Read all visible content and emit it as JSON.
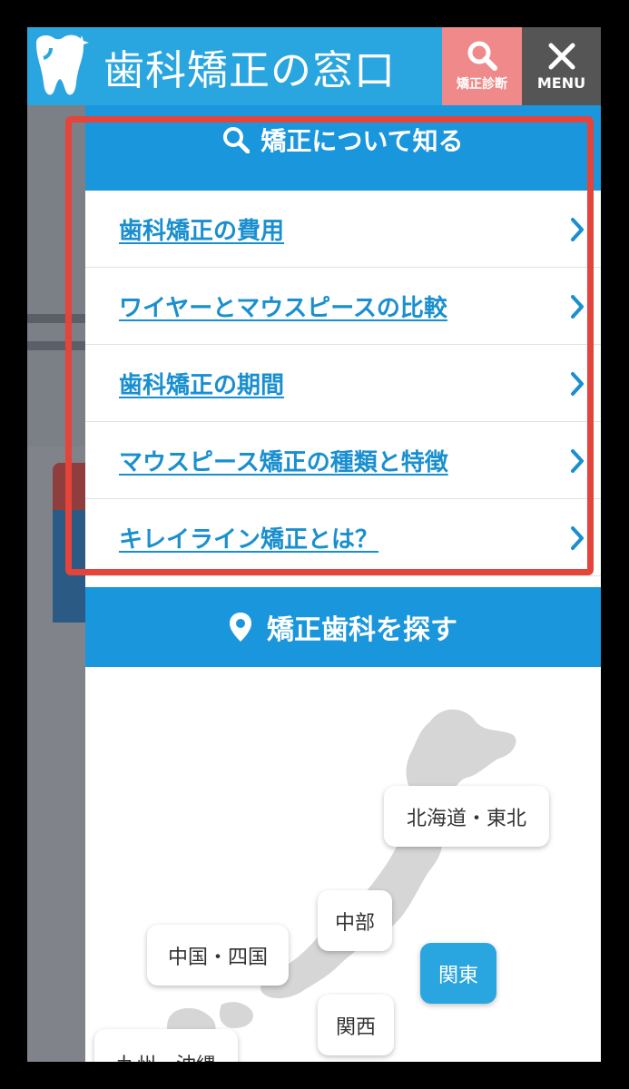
{
  "header": {
    "site_title": "歯科矯正の窓口",
    "diagnosis_label": "矯正診断",
    "menu_label": "MENU"
  },
  "drawer": {
    "learn_section": {
      "heading": "矯正について知る",
      "items": [
        {
          "label": "歯科矯正の費用"
        },
        {
          "label": "ワイヤーとマウスピースの比較"
        },
        {
          "label": "歯科矯正の期間"
        },
        {
          "label": "マウスピース矯正の種類と特徴"
        },
        {
          "label": "キレイライン矯正とは？"
        }
      ]
    },
    "search_section": {
      "heading": "矯正歯科を探す",
      "regions": [
        {
          "label": "北海道・東北",
          "active": false
        },
        {
          "label": "中部",
          "active": false
        },
        {
          "label": "中国・四国",
          "active": false
        },
        {
          "label": "関東",
          "active": true
        },
        {
          "label": "関西",
          "active": false
        },
        {
          "label": "九州・沖縄",
          "active": false
        }
      ]
    }
  },
  "colors": {
    "brand_blue": "#29a5e0",
    "section_blue": "#1a96dc",
    "diagnosis_pink": "#f08a8a",
    "menu_gray": "#555555",
    "highlight_red": "#e5443a"
  },
  "icons": [
    "tooth-logo-icon",
    "search-icon",
    "close-icon",
    "chevron-right-icon",
    "map-pin-icon"
  ]
}
